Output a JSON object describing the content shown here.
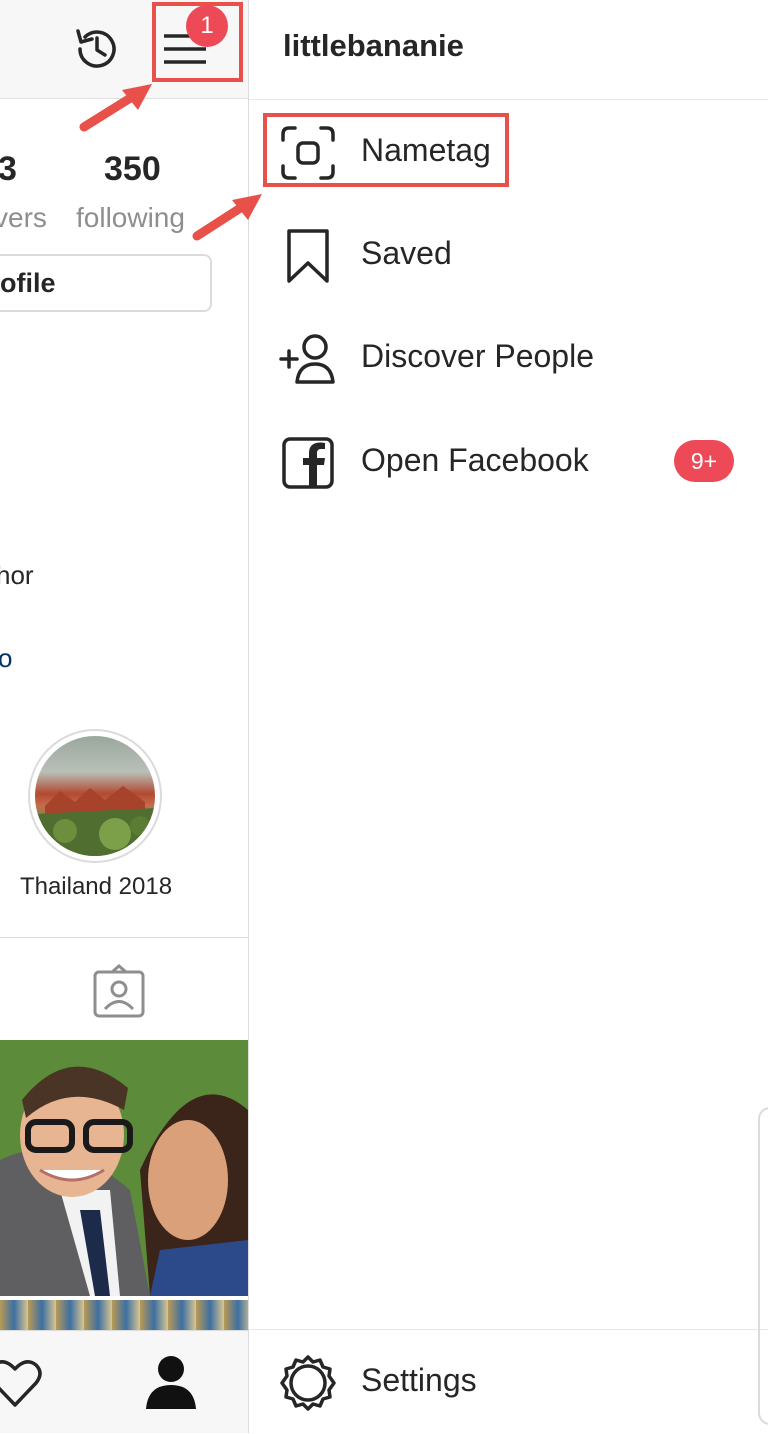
{
  "profile": {
    "followers_count": "3",
    "followers_label": "vers",
    "following_count": "350",
    "following_label": "following",
    "edit_button": "ofile",
    "bio_text": "hor",
    "bio_link": "o",
    "highlight_label": "Thailand 2018",
    "notification_count": "1"
  },
  "drawer": {
    "username": "littlebananie",
    "items": [
      {
        "label": "Nametag",
        "icon": "nametag-icon"
      },
      {
        "label": "Saved",
        "icon": "bookmark-icon"
      },
      {
        "label": "Discover People",
        "icon": "add-person-icon"
      },
      {
        "label": "Open Facebook",
        "icon": "facebook-icon",
        "badge": "9+"
      }
    ],
    "settings_label": "Settings"
  },
  "colors": {
    "accent_red": "#ed4956",
    "annotation_red": "#e8504a",
    "text": "#262626",
    "muted": "#8e8e8e"
  }
}
